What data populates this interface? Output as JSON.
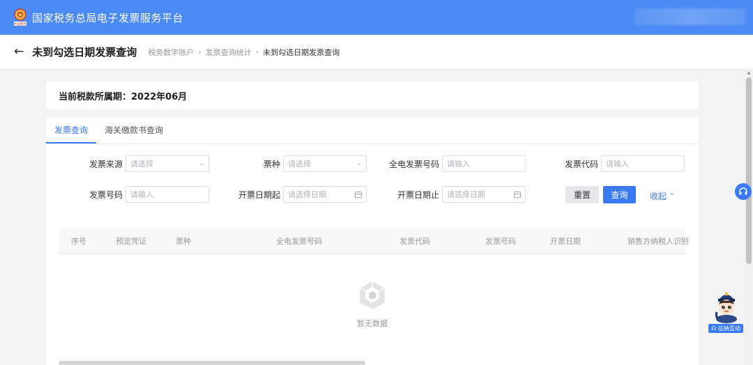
{
  "header": {
    "platform_title": "国家税务总局电子发票服务平台",
    "emblem_caption": "中国税务"
  },
  "subheader": {
    "page_title": "未到勾选日期发票查询",
    "breadcrumb": [
      "税务数字账户",
      "发票查询统计",
      "未到勾选日期发票查询"
    ]
  },
  "period": {
    "label": "当前税款所属期：2022年06月"
  },
  "tabs": [
    {
      "label": "发票查询",
      "active": true
    },
    {
      "label": "海关缴款书查询",
      "active": false
    }
  ],
  "form": {
    "invoice_source": {
      "label": "发票来源",
      "placeholder": "请选择"
    },
    "ticket_type": {
      "label": "票种",
      "placeholder": "请选择"
    },
    "full_invoice_no": {
      "label": "全电发票号码",
      "placeholder": "请输入"
    },
    "invoice_code": {
      "label": "发票代码",
      "placeholder": "请输入"
    },
    "invoice_no": {
      "label": "发票号码",
      "placeholder": "请输入"
    },
    "date_from": {
      "label": "开票日期起",
      "placeholder": "请选择日期"
    },
    "date_to": {
      "label": "开票日期止",
      "placeholder": "请选择日期"
    },
    "reset_label": "重置",
    "query_label": "查询",
    "collapse_label": "收起"
  },
  "table": {
    "columns": [
      "序号",
      "预览凭证",
      "票种",
      "全电发票号码",
      "发票代码",
      "发票号码",
      "开票日期",
      "销售方纳税人识别"
    ],
    "empty_text": "暂无数据"
  },
  "floating": {
    "mascot_label": "征纳互动"
  },
  "colors": {
    "topbar": "#4a8af4",
    "accent": "#3a7bf5"
  }
}
